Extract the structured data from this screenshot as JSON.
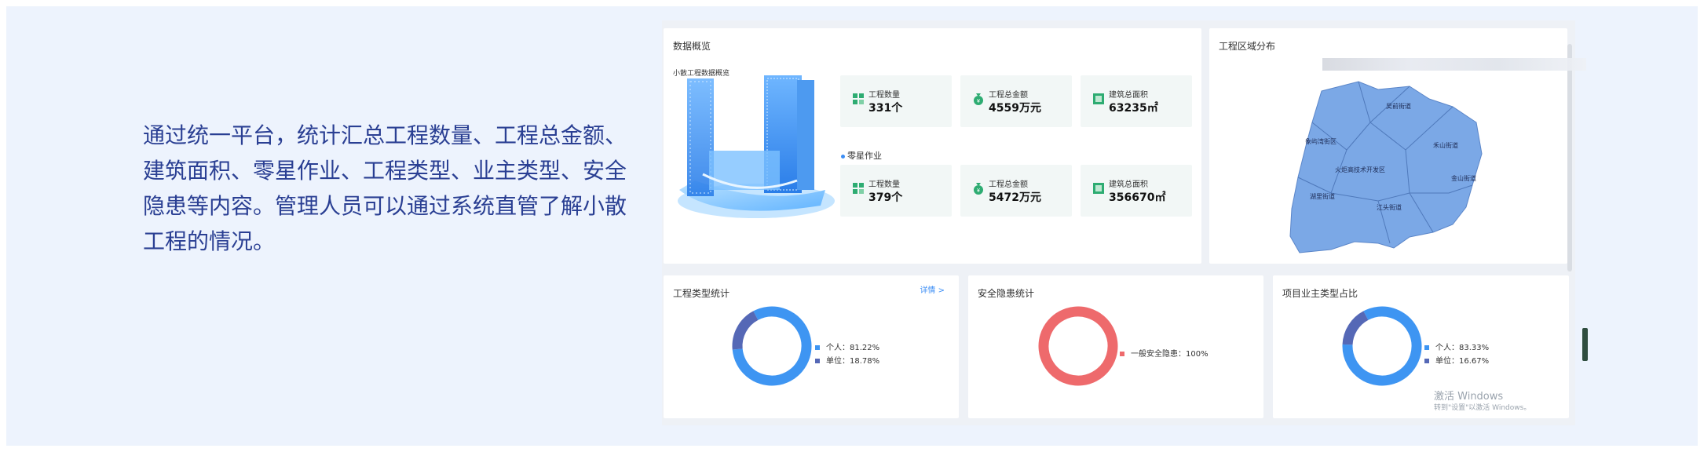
{
  "description": {
    "lines": [
      "通过统一平台，统计汇总工程数量、工程总金额、",
      "建筑面积、零星作业、工程类型、业主类型、安全",
      "隐患等内容。管理人员可以通过系统直管了解小散",
      "工程的情况。"
    ]
  },
  "overview": {
    "title": "数据概览",
    "subtitle": "小散工程数据概览",
    "stats_top": [
      {
        "label": "工程数量",
        "value": "331个",
        "icon": "grid-icon"
      },
      {
        "label": "工程总金额",
        "value": "4559万元",
        "icon": "money-bag-icon"
      },
      {
        "label": "建筑总面积",
        "value": "63235㎡",
        "icon": "area-icon"
      }
    ],
    "segment_label": "零星作业",
    "stats_bottom": [
      {
        "label": "工程数量",
        "value": "379个",
        "icon": "grid-icon"
      },
      {
        "label": "工程总金额",
        "value": "5472万元",
        "icon": "money-bag-icon"
      },
      {
        "label": "建筑总面积",
        "value": "356670㎡",
        "icon": "area-icon"
      }
    ]
  },
  "region": {
    "title": "工程区域分布",
    "districts": [
      "吴前街道",
      "象屿湾街区",
      "禾山街道",
      "火炬高技术开发区",
      "金山街道",
      "湖里街道",
      "江头街道"
    ]
  },
  "type_stats": {
    "title": "工程类型统计",
    "detail_label": "详情 >",
    "legend": [
      {
        "name": "个人",
        "value": "81.22%",
        "percent": 81.22,
        "color": "#3e95f2"
      },
      {
        "name": "单位",
        "value": "18.78%",
        "percent": 18.78,
        "color": "#5568b6"
      }
    ]
  },
  "safety_stats": {
    "title": "安全隐患统计",
    "legend": [
      {
        "name": "一般安全隐患",
        "value": "100%",
        "percent": 100,
        "color": "#ee6a6c"
      }
    ]
  },
  "owner_stats": {
    "title": "项目业主类型占比",
    "legend": [
      {
        "name": "个人",
        "value": "83.33%",
        "percent": 83.33,
        "color": "#3e95f2"
      },
      {
        "name": "单位",
        "value": "16.67%",
        "percent": 16.67,
        "color": "#5568b6"
      }
    ]
  },
  "watermark": {
    "line1": "激活 Windows",
    "line2": "转到\"设置\"以激活 Windows。"
  }
}
